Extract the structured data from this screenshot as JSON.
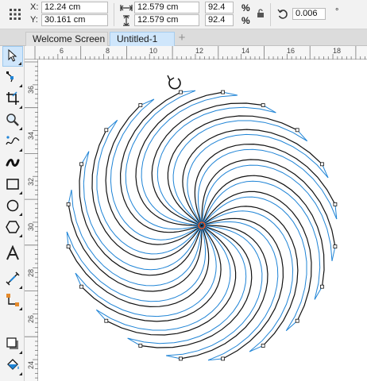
{
  "property_bar": {
    "x_label": "X:",
    "x_value": "12.24 cm",
    "y_label": "Y:",
    "y_value": "30.161 cm",
    "width_value": "12.579 cm",
    "height_value": "12.579 cm",
    "scale_x": "92.4",
    "scale_y": "92.4",
    "percent_symbol": "%",
    "rotation_value": "0.006",
    "degree_symbol": "°"
  },
  "tabs": [
    {
      "label": "Welcome Screen",
      "active": false
    },
    {
      "label": "Untitled-1",
      "active": true
    }
  ],
  "new_tab_label": "+",
  "toolbox": {
    "tools": [
      {
        "name": "pick-tool",
        "icon": "arrow-pointer-icon",
        "active": true
      },
      {
        "name": "shape-tool",
        "icon": "node-edit-icon"
      },
      {
        "name": "crop-tool",
        "icon": "crop-icon"
      },
      {
        "name": "zoom-tool",
        "icon": "magnifier-icon"
      },
      {
        "name": "freehand-tool",
        "icon": "freehand-icon"
      },
      {
        "name": "artistic-media-tool",
        "icon": "brush-stroke-icon"
      },
      {
        "name": "rectangle-tool",
        "icon": "rectangle-icon"
      },
      {
        "name": "ellipse-tool",
        "icon": "ellipse-icon"
      },
      {
        "name": "polygon-tool",
        "icon": "polygon-icon"
      },
      {
        "name": "text-tool",
        "icon": "text-a-icon"
      },
      {
        "name": "dimension-tool",
        "icon": "parallel-dimension-icon"
      },
      {
        "name": "connector-tool",
        "icon": "connector-icon"
      },
      {
        "name": "drop-shadow-tool",
        "icon": "drop-shadow-icon"
      },
      {
        "name": "fill-tool",
        "icon": "paint-bucket-icon"
      }
    ]
  },
  "ruler": {
    "horizontal_labels": [
      "6",
      "8",
      "10",
      "12",
      "14",
      "16",
      "18"
    ],
    "vertical_labels": [
      "36",
      "34",
      "32",
      "30",
      "28",
      "26",
      "24"
    ]
  },
  "drawing": {
    "black_stroke": "#111111",
    "blue_stroke": "#1f84d6",
    "center_marker_color": "#e0562a",
    "arms": 20
  },
  "colors": {
    "active_tab": "#cfe6fb",
    "active_tool": "#cfe6fb"
  }
}
